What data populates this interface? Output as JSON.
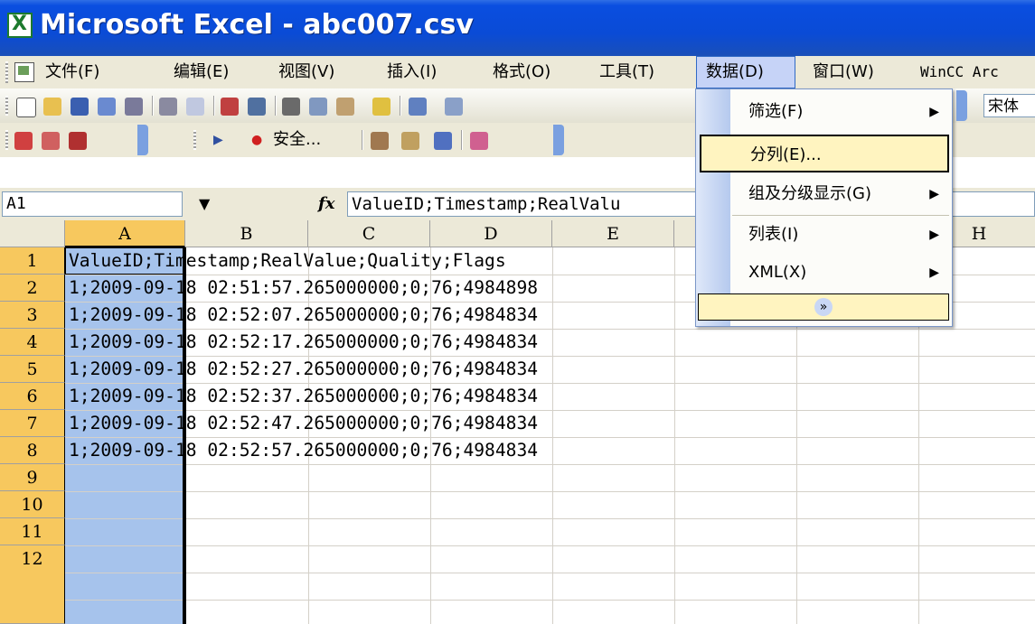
{
  "window": {
    "title": "Microsoft Excel - abc007.csv"
  },
  "menu": {
    "items": [
      "文件(F)",
      "编辑(E)",
      "视图(V)",
      "插入(I)",
      "格式(O)",
      "工具(T)",
      "数据(D)",
      "窗口(W)",
      "WinCC Arc"
    ],
    "active": "数据(D)"
  },
  "toolbar2": {
    "security_label": "安全..."
  },
  "font_box": {
    "value": "宋体"
  },
  "formula_bar": {
    "name_box": "A1",
    "fx": "fx",
    "content": "ValueID;Timestamp;RealValu"
  },
  "sheet": {
    "columns": [
      "A",
      "B",
      "C",
      "D",
      "E",
      "",
      "",
      "H"
    ],
    "rows": [
      "1",
      "2",
      "3",
      "4",
      "5",
      "6",
      "7",
      "8",
      "9",
      "10",
      "11",
      "12"
    ],
    "cells": [
      "ValueID;Timestamp;RealValue;Quality;Flags",
      "1;2009-09-18 02:51:57.265000000;0;76;4984898",
      "1;2009-09-18 02:52:07.265000000;0;76;4984834",
      "1;2009-09-18 02:52:17.265000000;0;76;4984834",
      "1;2009-09-18 02:52:27.265000000;0;76;4984834",
      "1;2009-09-18 02:52:37.265000000;0;76;4984834",
      "1;2009-09-18 02:52:47.265000000;0;76;4984834",
      "1;2009-09-18 02:52:57.265000000;0;76;4984834"
    ]
  },
  "data_menu": {
    "items": [
      {
        "label": "筛选(F)",
        "submenu": true
      },
      {
        "label": "分列(E)...",
        "submenu": false
      },
      {
        "label": "组及分级显示(G)",
        "submenu": true
      },
      {
        "label": "列表(I)",
        "submenu": true
      },
      {
        "label": "XML(X)",
        "submenu": true
      }
    ],
    "expand_label": "»"
  }
}
